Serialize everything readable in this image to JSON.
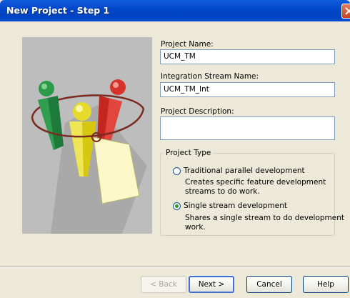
{
  "window": {
    "title": "New Project - Step 1"
  },
  "colors": {
    "titlebar": "#0047c8",
    "close_button": "#c6411c",
    "dialog_bg": "#ece9d8",
    "radio_dot": "#21a121"
  },
  "illustration": {
    "icon": "project-people-illustration"
  },
  "form": {
    "project_name": {
      "label": "Project Name:",
      "value": "UCM_TM"
    },
    "integration_stream": {
      "label": "Integration Stream Name:",
      "value": "UCM_TM_Int"
    },
    "description": {
      "label": "Project Description:",
      "value": ""
    }
  },
  "project_type": {
    "legend": "Project Type",
    "options": [
      {
        "label": "Traditional parallel development",
        "description_lines": [
          "Creates specific feature development",
          "streams to do work."
        ],
        "checked": false
      },
      {
        "label": "Single stream development",
        "description_lines": [
          "Shares a single stream to do development",
          "work."
        ],
        "checked": true
      }
    ]
  },
  "buttons": {
    "back": "< Back",
    "next": "Next >",
    "cancel": "Cancel",
    "help": "Help"
  }
}
